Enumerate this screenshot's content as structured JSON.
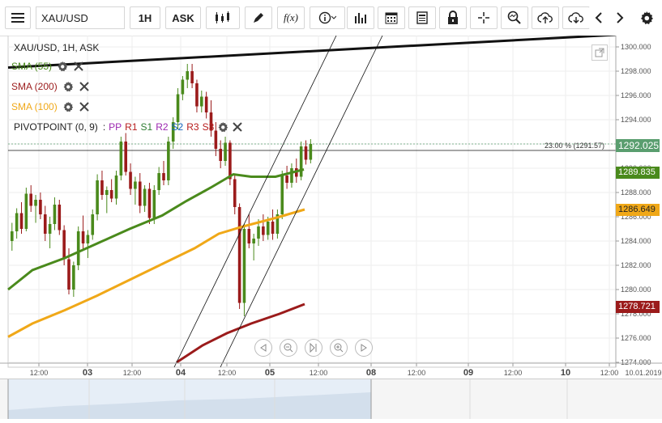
{
  "toolbar": {
    "symbol": "XAU/USD",
    "timeframe": "1H",
    "price_type": "ASK"
  },
  "chart_title": "XAU/USD, 1H, ASK",
  "indicators": [
    {
      "label": "SMA (55)",
      "color": "#4a8a1c"
    },
    {
      "label": "SMA (200)",
      "color": "#9b1b1b"
    },
    {
      "label": "SMA (100)",
      "color": "#f0a818"
    }
  ],
  "pivot": {
    "label": "PIVOTPOINT (0, 9)",
    "sep": ":",
    "items": [
      {
        "t": "PP",
        "color": "#9c27b0"
      },
      {
        "t": "R1",
        "color": "#b71c1c"
      },
      {
        "t": "S1",
        "color": "#2e7d32"
      },
      {
        "t": "R2",
        "color": "#9c27b0"
      },
      {
        "t": "S2",
        "color": "#1565c0"
      },
      {
        "t": "R3",
        "color": "#b71c1c"
      },
      {
        "t": "S3",
        "color": "#b71c1c"
      }
    ]
  },
  "fib_label": "23.00 % (1291.57)",
  "price_tags": {
    "current": {
      "value": "1292.025",
      "bg": "#5a9e6f",
      "fg": "#ffffff"
    },
    "sma55": {
      "value": "1289.835",
      "bg": "#4a8a1c",
      "fg": "#ffffff"
    },
    "sma100": {
      "value": "1286.649",
      "bg": "#f0a818",
      "fg": "#222222"
    },
    "sma200": {
      "value": "1278.721",
      "bg": "#9b1b1b",
      "fg": "#ffffff"
    }
  },
  "y_axis": [
    "1300.000",
    "1298.000",
    "1296.000",
    "1294.000",
    "1292.000",
    "1290.000",
    "1288.000",
    "1286.000",
    "1284.000",
    "1282.000",
    "1280.000",
    "1278.000",
    "1276.000",
    "1274.000"
  ],
  "x_axis": [
    {
      "t": "12:00",
      "bold": false
    },
    {
      "t": "03",
      "bold": true
    },
    {
      "t": "12:00",
      "bold": false
    },
    {
      "t": "04",
      "bold": true
    },
    {
      "t": "12:00",
      "bold": false
    },
    {
      "t": "05",
      "bold": true
    },
    {
      "t": "12:00",
      "bold": false
    },
    {
      "t": "08",
      "bold": true
    },
    {
      "t": "12:00",
      "bold": false
    },
    {
      "t": "09",
      "bold": true
    },
    {
      "t": "12:00",
      "bold": false
    },
    {
      "t": "10",
      "bold": true
    },
    {
      "t": "12:00",
      "bold": false
    }
  ],
  "x_axis_end": "10.01.2019",
  "colors": {
    "bull": "#4a8a1c",
    "bear": "#9b1b1b",
    "trend": "#111111"
  }
}
